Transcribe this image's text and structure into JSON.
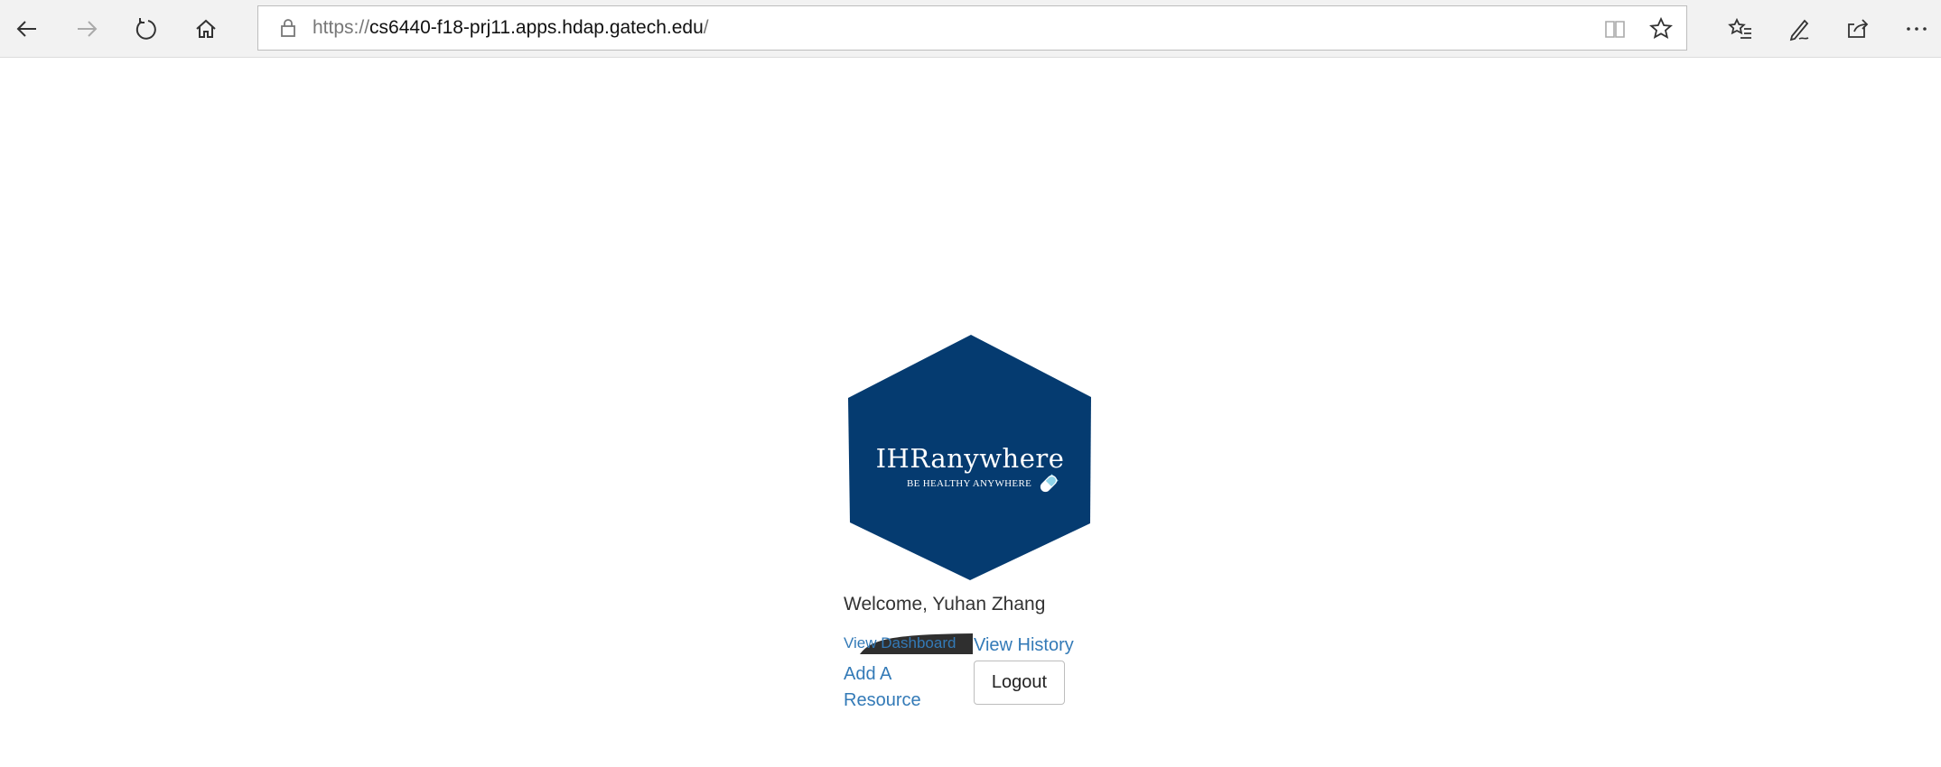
{
  "browser": {
    "url_scheme": "https://",
    "url_host": "cs6440-f18-prj11.apps.hdap.gatech.edu",
    "url_trail": "/",
    "icons": [
      "back-icon",
      "forward-icon",
      "refresh-icon",
      "home-icon",
      "lock-icon",
      "reading-view-icon",
      "favorite-star-icon",
      "favorites-list-icon",
      "pen-icon",
      "share-icon",
      "more-icon"
    ]
  },
  "logo": {
    "title": "IHRanywhere",
    "tagline": "BE HEALTHY ANYWHERE",
    "color": "#053b70"
  },
  "welcome_text": "Welcome, Yuhan Zhang",
  "links": {
    "dashboard": "View Dashboard",
    "history": "View History",
    "add_resource": "Add A Resource"
  },
  "logout_label": "Logout",
  "colors": {
    "link": "#337ab7",
    "toolbar": "#f2f2f2"
  }
}
